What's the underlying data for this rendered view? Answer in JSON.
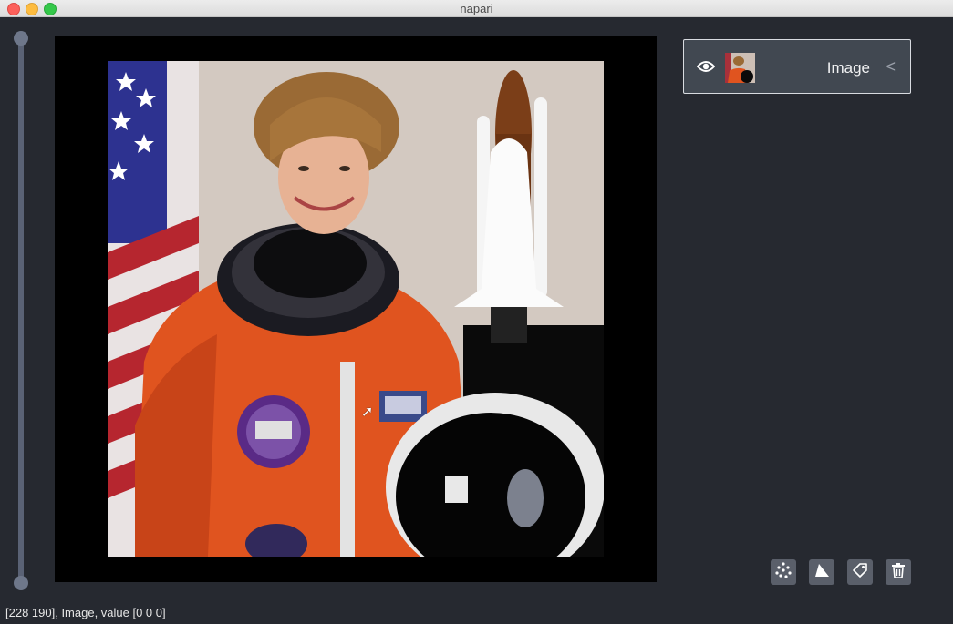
{
  "window": {
    "title": "napari"
  },
  "layers": [
    {
      "name": "Image",
      "visible": true,
      "expanded": false
    }
  ],
  "status": {
    "text": "[228 190], Image, value [0 0 0]"
  },
  "buttons": {
    "new_points": "new-points-icon",
    "new_shapes": "new-shapes-icon",
    "new_labels": "new-labels-icon",
    "delete": "delete-layer-icon"
  },
  "colors": {
    "background": "#262930",
    "panel_item": "#414851",
    "button": "#5a5f6a"
  }
}
